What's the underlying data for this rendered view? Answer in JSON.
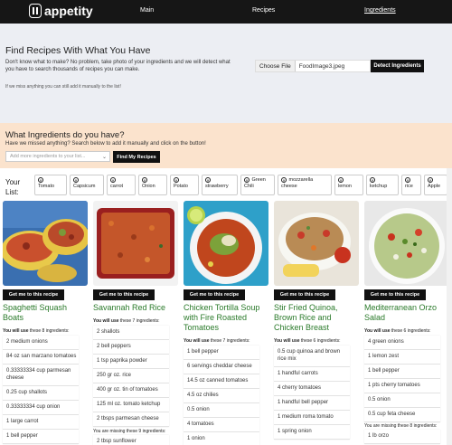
{
  "nav": {
    "logo_text": "appetity",
    "links": [
      "Main",
      "Recipes",
      "Ingredients"
    ],
    "active": "Ingredients"
  },
  "hero": {
    "title": "Find Recipes With What You Have",
    "subtitle": "Don't know what to make? No problem, take photo of your ingredients and we will detect what you have to search thousands of recipes you can make.",
    "note": "If we miss anything you can still add it manually to the list!",
    "choose_file_label": "Choose File",
    "file_name": "FoodImage3.jpeg",
    "detect_label": "Detect Ingredients"
  },
  "ingredients_panel": {
    "title": "What Ingredients do you have?",
    "subtitle": "Have we missed anything? Search below to add it manually and click on the button!",
    "search_placeholder": "Add more ingredients to your list...",
    "find_label": "Find My Recipes"
  },
  "your_list": {
    "label": "Your List:",
    "items": [
      "Tomato",
      "Capsicum",
      "carrot",
      "Onion",
      "Potato",
      "strawberry",
      "Green Chili",
      "mozzarella cheese",
      "lemon",
      "ketchup",
      "rice",
      "Apple"
    ]
  },
  "recipes": [
    {
      "title": "Spaghetti Squash Boats",
      "button": "Get me to this recipe",
      "uses_prefix": "You will use",
      "uses_text": "these 8 ingredients:",
      "ingredients": [
        "2 medium onions",
        "84 oz san marzano tomatoes",
        "0.33333334 cup parmesan cheese",
        "0.25 cup shallots",
        "0.33333334 cup onion",
        "1 large carrot",
        "1 bell pepper"
      ],
      "missing_text": ""
    },
    {
      "title": "Savannah Red Rice",
      "button": "Get me to this recipe",
      "uses_prefix": "You will use",
      "uses_text": "these 7 ingredients:",
      "ingredients": [
        "2 shallots",
        "2 bell peppers",
        "1 tsp paprika powder",
        "250 gr oz. rice",
        "400 gr oz. tin of tomatoes",
        "125 ml oz. tomato ketchup",
        "2 tbsps parmesan cheese"
      ],
      "missing_text": "You are missing these 9 ingredients:",
      "after_missing": [
        "2 tbsp sunflower"
      ]
    },
    {
      "title": "Chicken Tortilla Soup with Fire Roasted Tomatoes",
      "button": "Get me to this recipe",
      "uses_prefix": "You will use",
      "uses_text": "these 7 ingredients:",
      "ingredients": [
        "1 bell pepper",
        "6 servings cheddar cheese",
        "14.5 oz canned tomatoes",
        "4.5 oz chilies",
        "0.5 onion",
        "4 tomatoes",
        "1 onion"
      ],
      "missing_text": ""
    },
    {
      "title": "Stir Fried Quinoa, Brown Rice and Chicken Breast",
      "button": "Get me to this recipe",
      "uses_prefix": "You will use",
      "uses_text": "these 6 ingredients:",
      "ingredients": [
        "0.5 cup quinoa and brown rice mix",
        "1 handful carrots",
        "4 cherry tomatoes",
        "1 handful bell pepper",
        "1 medium roma tomato",
        "1 spring onion"
      ],
      "missing_text": ""
    },
    {
      "title": "Mediterranean Orzo Salad",
      "button": "Get me to this recipe",
      "uses_prefix": "You will use",
      "uses_text": "these 6 ingredients:",
      "ingredients": [
        "4 green onions",
        "1 lemon zest",
        "1 bell pepper",
        "1 pts cherry tomatoes",
        "0.5 onion",
        "0.5 cup feta cheese"
      ],
      "missing_text": "You are missing these 8 ingredients:",
      "after_missing": [
        "1 lb orzo"
      ]
    }
  ]
}
